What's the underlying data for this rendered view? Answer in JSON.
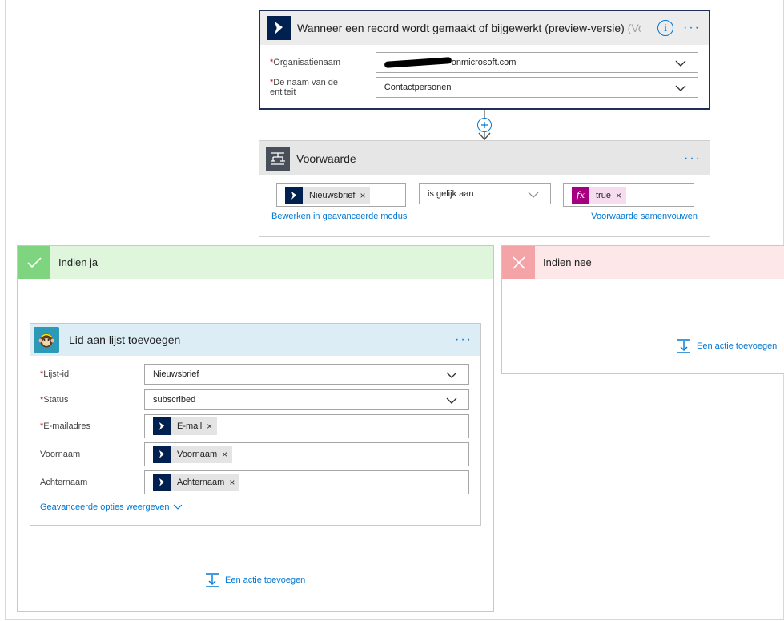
{
  "trigger": {
    "title": "Wanneer een record wordt gemaakt of bijgewerkt (preview-versie)",
    "title_suffix": "(Vo...",
    "info_glyph": "i",
    "more_glyph": "···",
    "org_label": "Organisatienaam",
    "org_value": "onmicrosoft.com",
    "entity_label_line1": "De naam van de",
    "entity_label_line2": "entiteit",
    "entity_value": "Contactpersonen",
    "required_mark": "*"
  },
  "condition": {
    "title": "Voorwaarde",
    "more_glyph": "···",
    "left_token": "Nieuwsbrief",
    "operator": "is gelijk aan",
    "right_token": "true",
    "edit_advanced_link": "Bewerken in geavanceerde modus",
    "collapse_link": "Voorwaarde samenvouwen",
    "remove_glyph": "×"
  },
  "branch_yes": {
    "title": "Indien ja",
    "add_action": "Een actie toevoegen"
  },
  "branch_no": {
    "title": "Indien nee",
    "add_action": "Een actie toevoegen"
  },
  "action": {
    "title": "Lid aan lijst toevoegen",
    "more_glyph": "···",
    "list_label": "Lijst-id",
    "list_value": "Nieuwsbrief",
    "status_label": "Status",
    "status_value": "subscribed",
    "email_label": "E-mailadres",
    "email_token": "E-mail",
    "firstname_label": "Voornaam",
    "firstname_token": "Voornaam",
    "lastname_label": "Achternaam",
    "lastname_token": "Achternaam",
    "advanced_link": "Geavanceerde opties weergeven",
    "remove_glyph": "×"
  },
  "colors": {
    "dynamics": "#002050",
    "accent": "#0078d4",
    "yes_header": "#dff6dd",
    "yes_check": "#7fd47f",
    "no_header": "#fde7e9",
    "no_x": "#f4a3a6",
    "mailchimp_header": "#dff0f8",
    "fx": "#a4007f"
  }
}
